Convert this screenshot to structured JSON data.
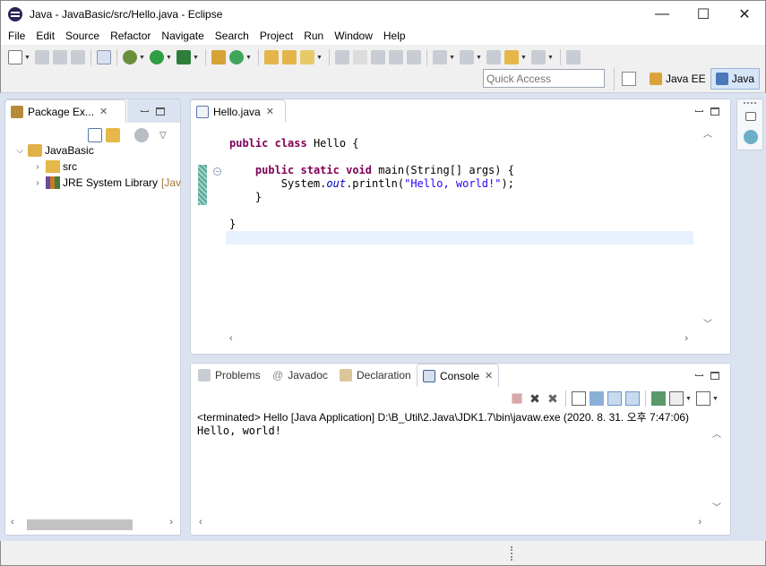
{
  "window": {
    "title": "Java - JavaBasic/src/Hello.java - Eclipse",
    "minimize": "—",
    "maximize": "☐",
    "close": "✕"
  },
  "menu": [
    "File",
    "Edit",
    "Source",
    "Refactor",
    "Navigate",
    "Search",
    "Project",
    "Run",
    "Window",
    "Help"
  ],
  "quick_access": {
    "placeholder": "Quick Access"
  },
  "perspectives": [
    {
      "label": "Java EE",
      "active": false
    },
    {
      "label": "Java",
      "active": true
    }
  ],
  "package_explorer": {
    "tab_label": "Package Ex...",
    "tree": {
      "project": "JavaBasic",
      "children": [
        {
          "label": "src",
          "decoration": ""
        },
        {
          "label": "JRE System Library",
          "decoration": "[Jav"
        }
      ]
    }
  },
  "editor": {
    "tab_label": "Hello.java",
    "code_lines": [
      {
        "parts": [
          [
            "kw",
            "public"
          ],
          [
            "",
            " "
          ],
          [
            "kw",
            "class"
          ],
          [
            "",
            " Hello {"
          ]
        ]
      },
      {
        "parts": []
      },
      {
        "parts": [
          [
            "",
            "    "
          ],
          [
            "kw",
            "public"
          ],
          [
            "",
            " "
          ],
          [
            "kw",
            "static"
          ],
          [
            "",
            " "
          ],
          [
            "kw",
            "void"
          ],
          [
            "",
            " main(String[] args) {"
          ]
        ]
      },
      {
        "parts": [
          [
            "",
            "        System."
          ],
          [
            "it",
            "out"
          ],
          [
            "",
            ".println("
          ],
          [
            "str",
            "\"Hello, world!\""
          ],
          [
            "",
            ");"
          ]
        ]
      },
      {
        "parts": [
          [
            "",
            "    }"
          ]
        ]
      },
      {
        "parts": []
      },
      {
        "parts": [
          [
            "",
            "}"
          ]
        ]
      },
      {
        "parts": []
      }
    ]
  },
  "bottom_tabs": [
    {
      "label": "Problems",
      "active": false
    },
    {
      "label": "Javadoc",
      "active": false
    },
    {
      "label": "Declaration",
      "active": false
    },
    {
      "label": "Console",
      "active": true
    }
  ],
  "console": {
    "status_line": "<terminated> Hello [Java Application] D:\\B_Util\\2.Java\\JDK1.7\\bin\\javaw.exe (2020. 8. 31. 오후 7:47:06)",
    "output": "Hello, world!"
  },
  "colors": {
    "keyword": "#7f0055",
    "string": "#2a00ff",
    "static_field": "#0000c0",
    "current_line": "#e8f2fe",
    "active_perspective": "#d6e5f7"
  }
}
